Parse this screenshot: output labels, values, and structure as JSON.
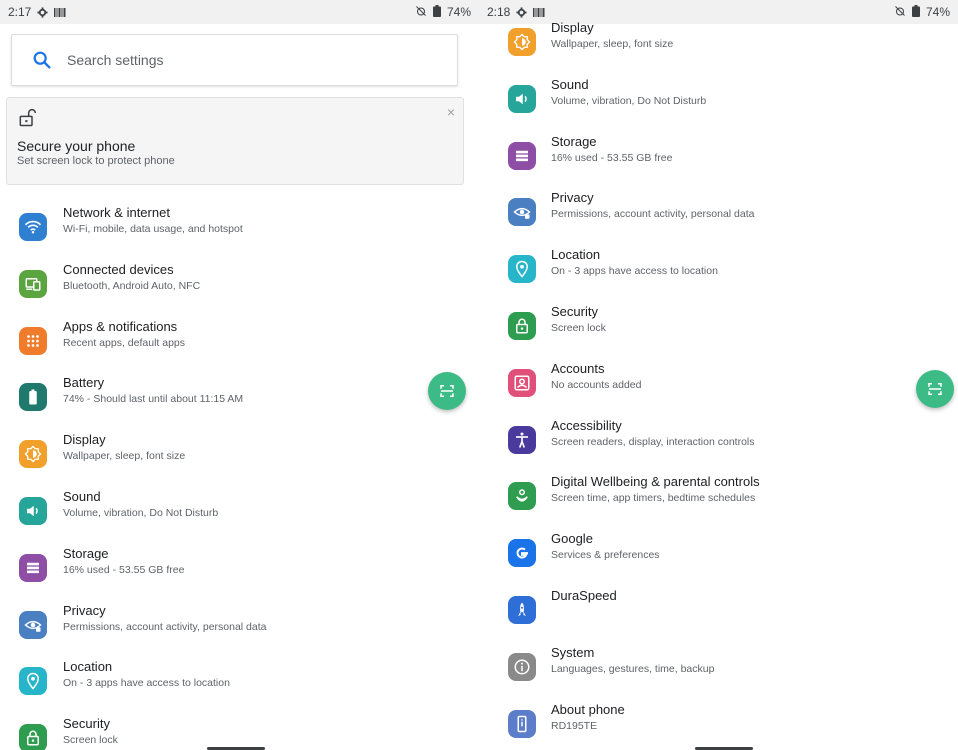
{
  "left": {
    "status": {
      "time": "2:17",
      "battery": "74%"
    },
    "search": {
      "placeholder": "Search settings"
    },
    "card": {
      "title": "Secure your phone",
      "subtitle": "Set screen lock to protect phone",
      "close": "×"
    },
    "items": [
      {
        "title": "Network & internet",
        "subtitle": "Wi-Fi, mobile, data usage, and hotspot",
        "color": "#2f80d1",
        "icon": "wifi-icon"
      },
      {
        "title": "Connected devices",
        "subtitle": "Bluetooth, Android Auto, NFC",
        "color": "#5aa53f",
        "icon": "connected-devices-icon"
      },
      {
        "title": "Apps & notifications",
        "subtitle": "Recent apps, default apps",
        "color": "#f07b2b",
        "icon": "apps-grid-icon"
      },
      {
        "title": "Battery",
        "subtitle": "74% - Should last until about 11:15 AM",
        "color": "#1f7a6d",
        "icon": "battery-icon"
      },
      {
        "title": "Display",
        "subtitle": "Wallpaper, sleep, font size",
        "color": "#f0a02b",
        "icon": "brightness-icon"
      },
      {
        "title": "Sound",
        "subtitle": "Volume, vibration, Do Not Disturb",
        "color": "#26a69a",
        "icon": "volume-icon"
      },
      {
        "title": "Storage",
        "subtitle": "16% used - 53.55 GB free",
        "color": "#8e4ea6",
        "icon": "storage-icon"
      },
      {
        "title": "Privacy",
        "subtitle": "Permissions, account activity, personal data",
        "color": "#4a7fc1",
        "icon": "privacy-eye-icon"
      },
      {
        "title": "Location",
        "subtitle": "On - 3 apps have access to location",
        "color": "#27b5c9",
        "icon": "location-pin-icon"
      },
      {
        "title": "Security",
        "subtitle": "Screen lock",
        "color": "#2e9d50",
        "icon": "lock-icon"
      }
    ]
  },
  "right": {
    "status": {
      "time": "2:18",
      "battery": "74%"
    },
    "items": [
      {
        "title": "Display",
        "subtitle": "Wallpaper, sleep, font size",
        "color": "#f0a02b",
        "icon": "brightness-icon"
      },
      {
        "title": "Sound",
        "subtitle": "Volume, vibration, Do Not Disturb",
        "color": "#26a69a",
        "icon": "volume-icon"
      },
      {
        "title": "Storage",
        "subtitle": "16% used - 53.55 GB free",
        "color": "#8e4ea6",
        "icon": "storage-icon"
      },
      {
        "title": "Privacy",
        "subtitle": "Permissions, account activity, personal data",
        "color": "#4a7fc1",
        "icon": "privacy-eye-icon"
      },
      {
        "title": "Location",
        "subtitle": "On - 3 apps have access to location",
        "color": "#27b5c9",
        "icon": "location-pin-icon"
      },
      {
        "title": "Security",
        "subtitle": "Screen lock",
        "color": "#2e9d50",
        "icon": "lock-icon"
      },
      {
        "title": "Accounts",
        "subtitle": "No accounts added",
        "color": "#e0507a",
        "icon": "account-box-icon"
      },
      {
        "title": "Accessibility",
        "subtitle": "Screen readers, display, interaction controls",
        "color": "#4b3a9e",
        "icon": "accessibility-icon"
      },
      {
        "title": "Digital Wellbeing & parental controls",
        "subtitle": "Screen time, app timers, bedtime schedules",
        "color": "#2e9d50",
        "icon": "wellbeing-icon"
      },
      {
        "title": "Google",
        "subtitle": "Services & preferences",
        "color": "#1a73e8",
        "icon": "google-icon"
      },
      {
        "title": "DuraSpeed",
        "subtitle": "",
        "color": "#2d6fd6",
        "icon": "rocket-icon"
      },
      {
        "title": "System",
        "subtitle": "Languages, gestures, time, backup",
        "color": "#8a8a8a",
        "icon": "info-icon"
      },
      {
        "title": "About phone",
        "subtitle": "RD195TE",
        "color": "#5c7dc9",
        "icon": "phone-icon"
      }
    ]
  }
}
